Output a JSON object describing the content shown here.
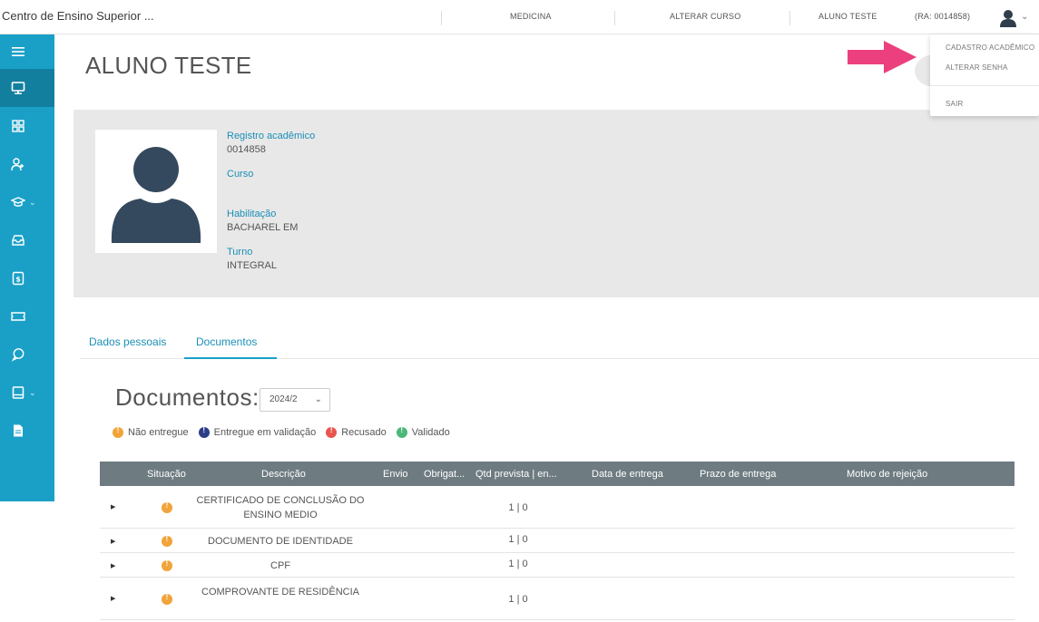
{
  "topbar": {
    "brand": "Centro de Ensino Superior ...",
    "course": "MEDICINA",
    "change_course": "ALTERAR CURSO",
    "user_name": "ALUNO TESTE",
    "ra": "(RA: 0014858)"
  },
  "user_menu": {
    "items": [
      "CADASTRO ACADÊMICO",
      "ALTERAR SENHA",
      "SAIR"
    ]
  },
  "page": {
    "title": "ALUNO TESTE"
  },
  "profile": {
    "registro_label": "Registro acadêmico",
    "registro_value": "0014858",
    "curso_label": "Curso",
    "curso_value": "",
    "habilitacao_label": "Habilitação",
    "habilitacao_value": "BACHAREL EM",
    "turno_label": "Turno",
    "turno_value": "INTEGRAL"
  },
  "tabs": {
    "dados": "Dados pessoais",
    "documentos": "Documentos"
  },
  "documents": {
    "heading": "Documentos:",
    "period": "2024/2",
    "legend": [
      {
        "label": "Não entregue",
        "color": "#f0a43a"
      },
      {
        "label": "Entregue em validação",
        "color": "#2c3e87"
      },
      {
        "label": "Recusado",
        "color": "#e8554e"
      },
      {
        "label": "Validado",
        "color": "#4cb87a"
      }
    ],
    "columns": [
      "Situação",
      "Descrição",
      "Envio",
      "Obrigat...",
      "Qtd prevista | en...",
      "Data de entrega",
      "Prazo de entrega",
      "Motivo de rejeição"
    ],
    "rows": [
      {
        "desc": "CERTIFICADO DE CONCLUSÃO DO ENSINO MEDIO",
        "qtd": "1 | 0"
      },
      {
        "desc": "DOCUMENTO DE IDENTIDADE",
        "qtd": "1 | 0"
      },
      {
        "desc": "CPF",
        "qtd": "1 | 0"
      },
      {
        "desc": "COMPROVANTE DE RESIDÊNCIA",
        "qtd": "1 | 0"
      }
    ]
  },
  "colors": {
    "sidebar": "#1aa0c7",
    "sidebar_active": "#137f9f",
    "table_header": "#6e7b81",
    "accent": "#1a8fb6",
    "arrow": "#ec3f7d"
  },
  "sidebar_icons": [
    "menu-icon",
    "monitor-icon",
    "grid-icon",
    "user-plus-icon",
    "graduation-cap-icon",
    "inbox-icon",
    "dollar-icon",
    "ticket-icon",
    "chat-icon",
    "book-icon",
    "file-icon"
  ]
}
